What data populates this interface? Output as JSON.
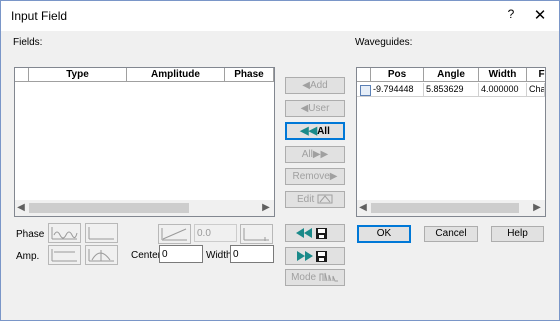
{
  "window": {
    "title": "Input Field",
    "help_glyph": "?",
    "close_glyph": "✕"
  },
  "fields": {
    "label": "Fields:",
    "columns": [
      "Type",
      "Amplitude",
      "Phase"
    ]
  },
  "waveguides": {
    "label": "Waveguides:",
    "columns": [
      "Pos",
      "Angle",
      "Width",
      "F"
    ],
    "rows": [
      {
        "checked": false,
        "pos": "-9.794448",
        "angle": "5.853629",
        "width": "4.000000",
        "f": "Cha"
      }
    ]
  },
  "actions": {
    "add": "Add",
    "user": "User",
    "all_add": "All",
    "all_remove": "All",
    "remove": "Remove",
    "edit": "Edit",
    "mode": "Mode"
  },
  "controls": {
    "phase_label": "Phase",
    "amp_label": "Amp.",
    "center_label": "Center",
    "center_value": "0",
    "width_label": "Width",
    "width_value": "0",
    "tilt_value": "0.0"
  },
  "dialog_buttons": {
    "ok": "OK",
    "cancel": "Cancel",
    "help": "Help"
  },
  "colors": {
    "accent": "#0078d7",
    "teal_arrow": "#1a8a8a",
    "disabled": "#a0a0a0"
  }
}
